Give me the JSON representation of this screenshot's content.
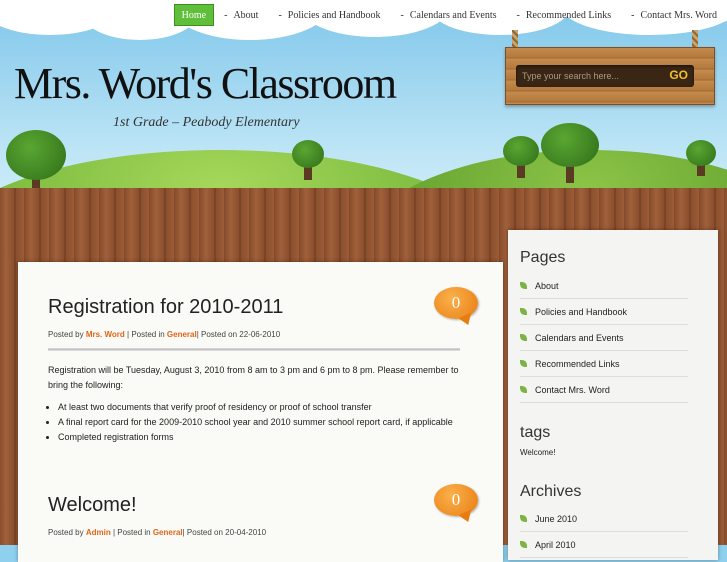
{
  "nav": {
    "items": [
      {
        "label": "Home",
        "active": true
      },
      {
        "label": "About"
      },
      {
        "label": "Policies and Handbook"
      },
      {
        "label": "Calendars and Events"
      },
      {
        "label": "Recommended Links"
      },
      {
        "label": "Contact Mrs. Word"
      }
    ],
    "dash": "-"
  },
  "header": {
    "title": "Mrs. Word's Classroom",
    "subtitle": "1st Grade – Peabody Elementary"
  },
  "search": {
    "placeholder": "Type your search here...",
    "go_label": "GO"
  },
  "posts": [
    {
      "title": "Registration for 2010-2011",
      "comments": "0",
      "meta_posted_by": "Posted by",
      "author": "Mrs. Word",
      "meta_posted_in": "| Posted in",
      "category": "General",
      "meta_posted_on": "| Posted on 22-06-2010",
      "body": "Registration will be Tuesday, August 3, 2010 from 8 am to 3 pm and 6 pm to 8 pm. Please remember to bring the following:",
      "bullets": [
        "At least two documents that verify proof of residency or proof of school transfer",
        "A final report card for the 2009-2010 school year and 2010 summer school report card, if applicable",
        "Completed registration forms"
      ]
    },
    {
      "title": "Welcome!",
      "comments": "0",
      "meta_posted_by": "Posted by",
      "author": "Admin",
      "meta_posted_in": "| Posted in",
      "category": "General",
      "meta_posted_on": "| Posted on 20-04-2010"
    }
  ],
  "sidebar": {
    "pages_heading": "Pages",
    "pages": [
      "About",
      "Policies and Handbook",
      "Calendars and Events",
      "Recommended Links",
      "Contact Mrs. Word"
    ],
    "tags_heading": "tags",
    "tags": [
      "Welcome!"
    ],
    "archives_heading": "Archives",
    "archives": [
      "June 2010",
      "April 2010"
    ]
  },
  "colors": {
    "accent_orange": "#e0651a",
    "nav_active_green": "#5fbf3a",
    "leaf_green": "#7cb342"
  }
}
